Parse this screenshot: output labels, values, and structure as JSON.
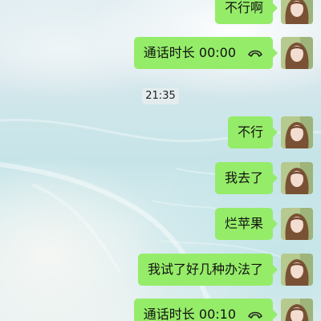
{
  "chat": {
    "timestamp": "21:35",
    "messages": [
      {
        "type": "text",
        "text": "不行啊"
      },
      {
        "type": "call",
        "text": "通话时长 00:00",
        "icon": "phone-hangup-icon"
      },
      {
        "type": "text",
        "text": "不行"
      },
      {
        "type": "text",
        "text": "我去了"
      },
      {
        "type": "text",
        "text": "烂苹果"
      },
      {
        "type": "text",
        "text": "我试了好几种办法了"
      },
      {
        "type": "call",
        "text": "通话时长 00:10",
        "icon": "phone-hangup-icon"
      }
    ]
  },
  "colors": {
    "bubble": "#95ec69",
    "avatar_hair": "#7a5134",
    "avatar_bg": "#b6c98e"
  }
}
